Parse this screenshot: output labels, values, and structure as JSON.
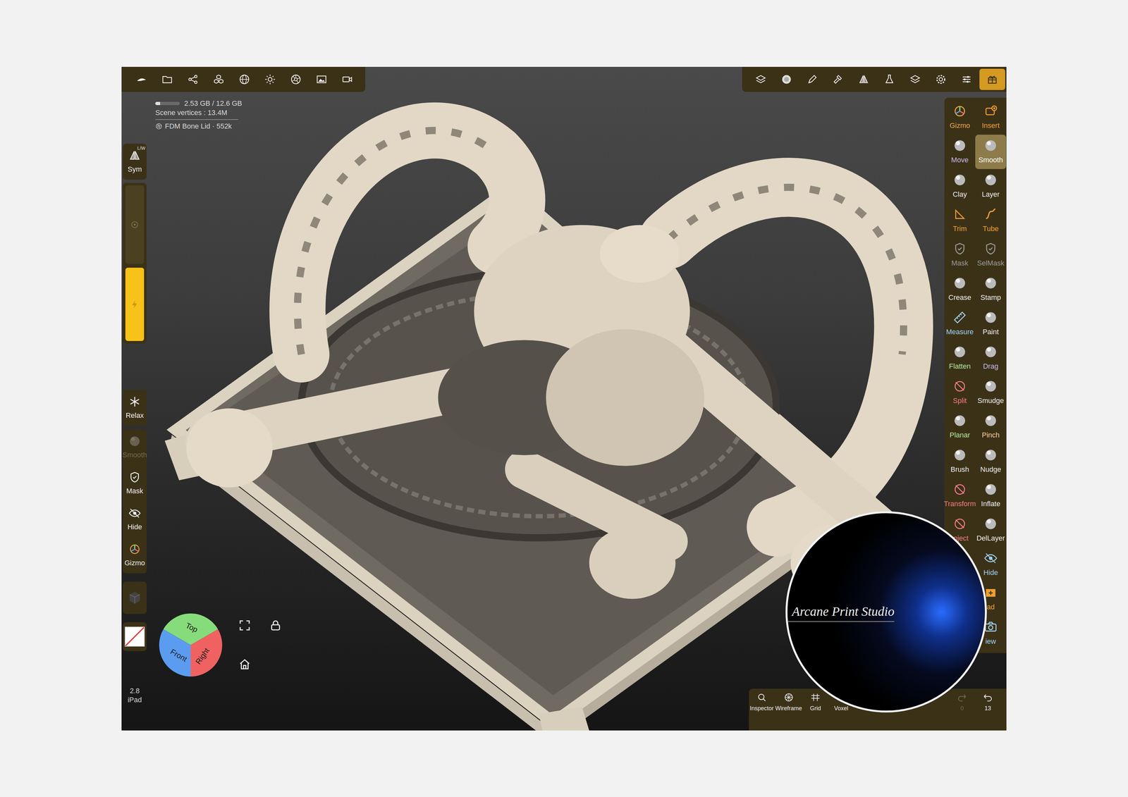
{
  "app": {
    "version": "2.8",
    "device": "iPad"
  },
  "stats": {
    "memory": "2.53 GB / 12.6 GB",
    "memory_level": 0.2,
    "vertices": "Scene vertices : 13.4M",
    "mesh": "FDM Bone Lid · 552k"
  },
  "top_left_toolbar": [
    {
      "selected": false
    },
    {
      "selected": false
    },
    {
      "selected": false
    },
    {
      "selected": false
    },
    {
      "selected": false
    },
    {
      "selected": false
    },
    {
      "selected": false
    },
    {
      "selected": false
    },
    {
      "selected": false
    }
  ],
  "top_right_toolbar": [
    {
      "selected": false
    },
    {
      "selected": false
    },
    {
      "selected": false
    },
    {
      "selected": false
    },
    {
      "selected": false
    },
    {
      "selected": false
    },
    {
      "selected": false
    },
    {
      "selected": false
    },
    {
      "selected": false
    },
    {
      "selected": true
    }
  ],
  "left_panel": {
    "symmetry": {
      "label": "Sym",
      "badge": "L/W"
    },
    "radius": {
      "level": 0.0
    },
    "intensity": {
      "level": 1.0
    },
    "relax": {
      "label": "Relax",
      "disabled": false
    },
    "items": [
      {
        "label": "Smooth",
        "disabled": true
      },
      {
        "label": "Mask",
        "disabled": false
      },
      {
        "label": "Hide",
        "disabled": false
      },
      {
        "label": "Gizmo",
        "disabled": false
      }
    ]
  },
  "tools": [
    {
      "label": "Gizmo",
      "selected": false,
      "color": "#e8a84a"
    },
    {
      "label": "Insert",
      "selected": false,
      "color": "#f0a030"
    },
    {
      "label": "Move",
      "selected": false,
      "color": "#c8b8e8"
    },
    {
      "label": "Smooth",
      "selected": true,
      "color": "#ffffff"
    },
    {
      "label": "Clay",
      "selected": false,
      "color": "#eeeeee"
    },
    {
      "label": "Layer",
      "selected": false,
      "color": "#eeeeee"
    },
    {
      "label": "Trim",
      "selected": false,
      "color": "#f0a030"
    },
    {
      "label": "Tube",
      "selected": false,
      "color": "#f0a030"
    },
    {
      "label": "Mask",
      "selected": false,
      "color": "#9a9a9a"
    },
    {
      "label": "SelMask",
      "selected": false,
      "color": "#9a9a9a"
    },
    {
      "label": "Crease",
      "selected": false,
      "color": "#eeeeee"
    },
    {
      "label": "Stamp",
      "selected": false,
      "color": "#eeeeee"
    },
    {
      "label": "Measure",
      "selected": false,
      "color": "#9fd0f0"
    },
    {
      "label": "Paint",
      "selected": false,
      "color": "#eeeeee"
    },
    {
      "label": "Flatten",
      "selected": false,
      "color": "#b8e8a0"
    },
    {
      "label": "Drag",
      "selected": false,
      "color": "#c8b8e8"
    },
    {
      "label": "Split",
      "selected": false,
      "color": "#f07a8a"
    },
    {
      "label": "Smudge",
      "selected": false,
      "color": "#eeeeee"
    },
    {
      "label": "Planar",
      "selected": false,
      "color": "#b8e8a0"
    },
    {
      "label": "Pinch",
      "selected": false,
      "color": "#f8d0a0"
    },
    {
      "label": "Brush",
      "selected": false,
      "color": "#eeeeee"
    },
    {
      "label": "Nudge",
      "selected": false,
      "color": "#eeeeee"
    },
    {
      "label": "Transform",
      "selected": false,
      "color": "#f07a8a"
    },
    {
      "label": "Inflate",
      "selected": false,
      "color": "#eeeeee"
    },
    {
      "label": "roject",
      "selected": false,
      "color": "#f07a8a"
    },
    {
      "label": "DelLayer",
      "selected": false,
      "color": "#eeeeee"
    },
    {
      "label": "Hide",
      "selected": false,
      "color": "#9fd0f0"
    },
    {
      "label": "ad",
      "selected": false,
      "color": "#f0a030"
    },
    {
      "label": "iew",
      "selected": false,
      "color": "#9fd0f0"
    }
  ],
  "nav_cube": {
    "top": "Top",
    "front": "Front",
    "right": "Right"
  },
  "bottom_bar": [
    {
      "label": "Inspector"
    },
    {
      "label": "Wireframe"
    },
    {
      "label": "Grid"
    },
    {
      "label": "Voxel"
    }
  ],
  "history": {
    "redo": "0",
    "redo_disabled": true,
    "undo": "13"
  },
  "watermark": {
    "text": "Arcane Print Studio"
  }
}
